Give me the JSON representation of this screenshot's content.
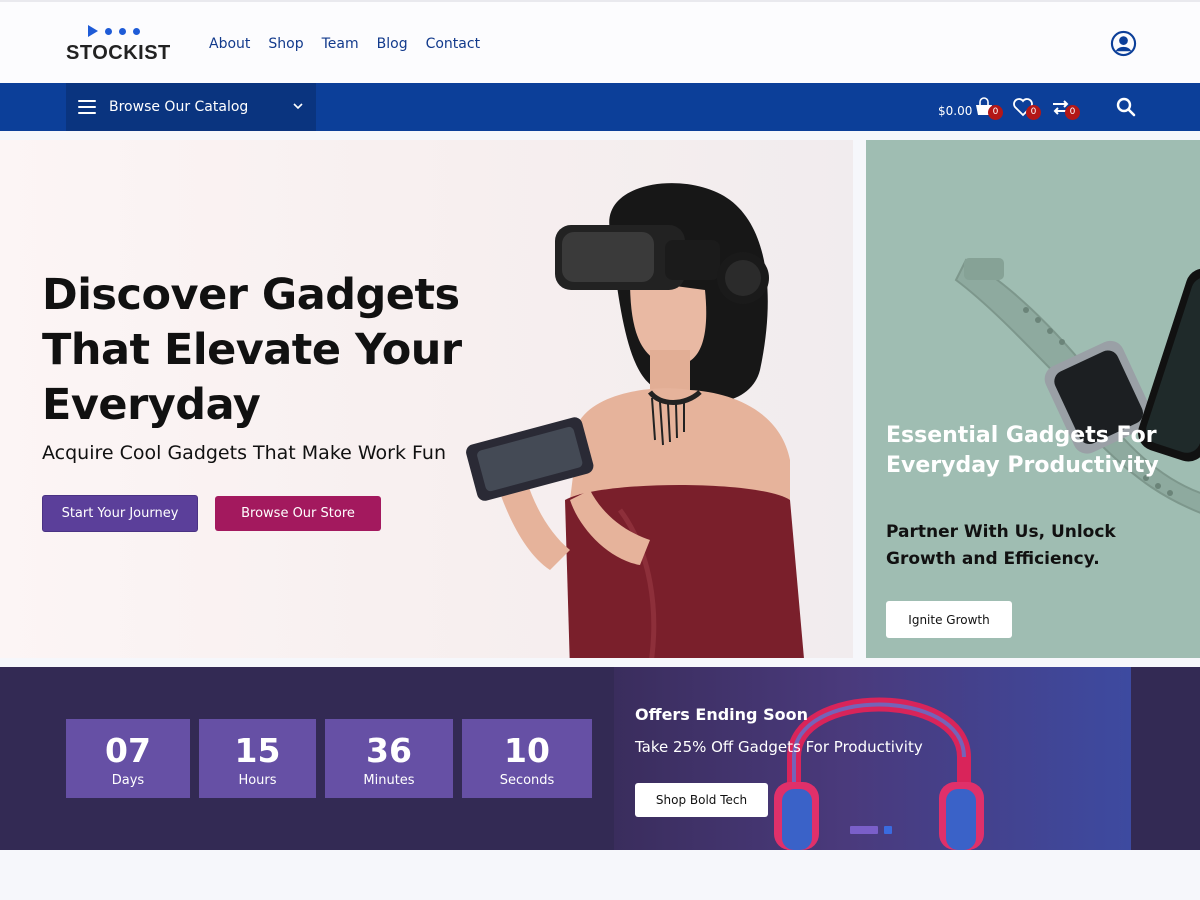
{
  "header": {
    "logo_text": "STOCKIST",
    "nav": [
      {
        "label": "About"
      },
      {
        "label": "Shop"
      },
      {
        "label": "Team"
      },
      {
        "label": "Blog"
      },
      {
        "label": "Contact"
      }
    ],
    "user_icon": "user-circle-icon"
  },
  "bluebar": {
    "catalog_label": "Browse Our Catalog",
    "cart_total": "$0.00",
    "cart_count": "0",
    "wishlist_count": "0",
    "compare_count": "0",
    "icons": [
      "menu-icon",
      "chevron-down-icon",
      "shopping-bag-icon",
      "heart-icon",
      "compare-arrows-icon",
      "search-icon"
    ]
  },
  "hero": {
    "title": "Discover Gadgets That Elevate Your Everyday",
    "subtitle": "Acquire Cool Gadgets That Make Work Fun",
    "primary_button": "Start Your Journey",
    "secondary_button": "Browse Our Store"
  },
  "side_banner": {
    "title": "Essential Gadgets For Everyday Productivity",
    "description": "Partner With Us, Unlock Growth and Efficiency.",
    "button": "Ignite Growth"
  },
  "countdown": {
    "items": [
      {
        "value": "07",
        "label": "Days"
      },
      {
        "value": "15",
        "label": "Hours"
      },
      {
        "value": "36",
        "label": "Minutes"
      },
      {
        "value": "10",
        "label": "Seconds"
      }
    ]
  },
  "promo": {
    "title": "Offers Ending Soon",
    "text": "Take 25% Off Gadgets For Productivity",
    "button": "Shop Bold Tech"
  },
  "colors": {
    "brand_blue": "#0c3f99",
    "catalog_dark": "#0a347f",
    "purple_button": "#5b3f9a",
    "magenta_button": "#a3195e",
    "countdown_box": "#6650a5",
    "countdown_bg": "#332a54",
    "badge_red": "#b31717",
    "side_banner_bg": "#9fbdb2"
  }
}
